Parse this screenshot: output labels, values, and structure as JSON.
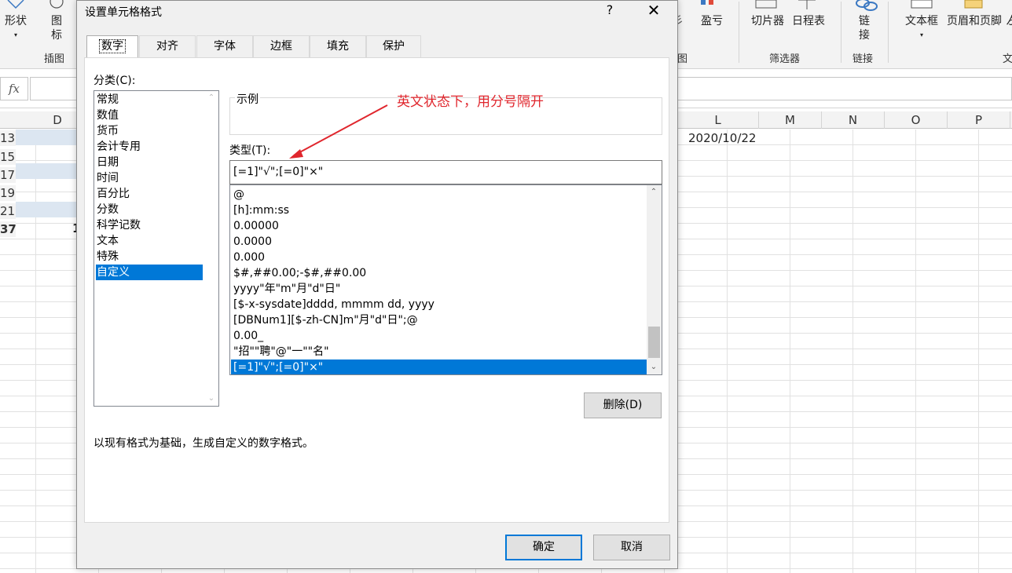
{
  "ribbon": {
    "shape_label": "形状",
    "icon_label_1": "图",
    "icon_label_2": "标",
    "illustrations_group": "插图",
    "pl_label": "盈亏",
    "chart_group_partial": "图",
    "slicer_label": "切片器",
    "timeline_label": "日程表",
    "filters_group": "筛选器",
    "link_label_1": "链",
    "link_label_2": "接",
    "links_group": "链接",
    "textbox_label": "文本框",
    "header_footer_label": "页眉和页脚",
    "text_group_partial": "文"
  },
  "sheet": {
    "columns": [
      "D",
      "L",
      "M",
      "N",
      "O",
      "P"
    ],
    "rows": [
      "13",
      "15",
      "17",
      "19",
      "21",
      "37"
    ],
    "cell_l": "2020/10/22",
    "cell_d_partial": "1"
  },
  "dialog": {
    "title": "设置单元格格式",
    "help": "?",
    "close": "✕",
    "tabs": [
      "数字",
      "对齐",
      "字体",
      "边框",
      "填充",
      "保护"
    ],
    "category_label": "分类(C):",
    "categories": [
      "常规",
      "数值",
      "货币",
      "会计专用",
      "日期",
      "时间",
      "百分比",
      "分数",
      "科学记数",
      "文本",
      "特殊",
      "自定义"
    ],
    "selected_category": "自定义",
    "sample_label": "示例",
    "type_label": "类型(T):",
    "type_value": "[=1]\"√\";[=0]\"×\"",
    "formats": [
      "@",
      "[h]:mm:ss",
      "0.00000",
      "0.0000",
      "0.000",
      "$#,##0.00;-$#,##0.00",
      "yyyy\"年\"m\"月\"d\"日\"",
      "[$-x-sysdate]dddd, mmmm dd, yyyy",
      "[DBNum1][$-zh-CN]m\"月\"d\"日\";@",
      "0.00_",
      "\"招\"\"聘\"@\"一\"\"名\"",
      "[=1]\"√\";[=0]\"×\""
    ],
    "delete_button": "删除(D)",
    "description": "以现有格式为基础，生成自定义的数字格式。",
    "ok_button": "确定",
    "cancel_button": "取消"
  },
  "annotation": {
    "text": "英文状态下，用分号隔开",
    "color": "#e0262d"
  },
  "colors": {
    "selection": "#0078d7",
    "band": "#dce6f1"
  }
}
